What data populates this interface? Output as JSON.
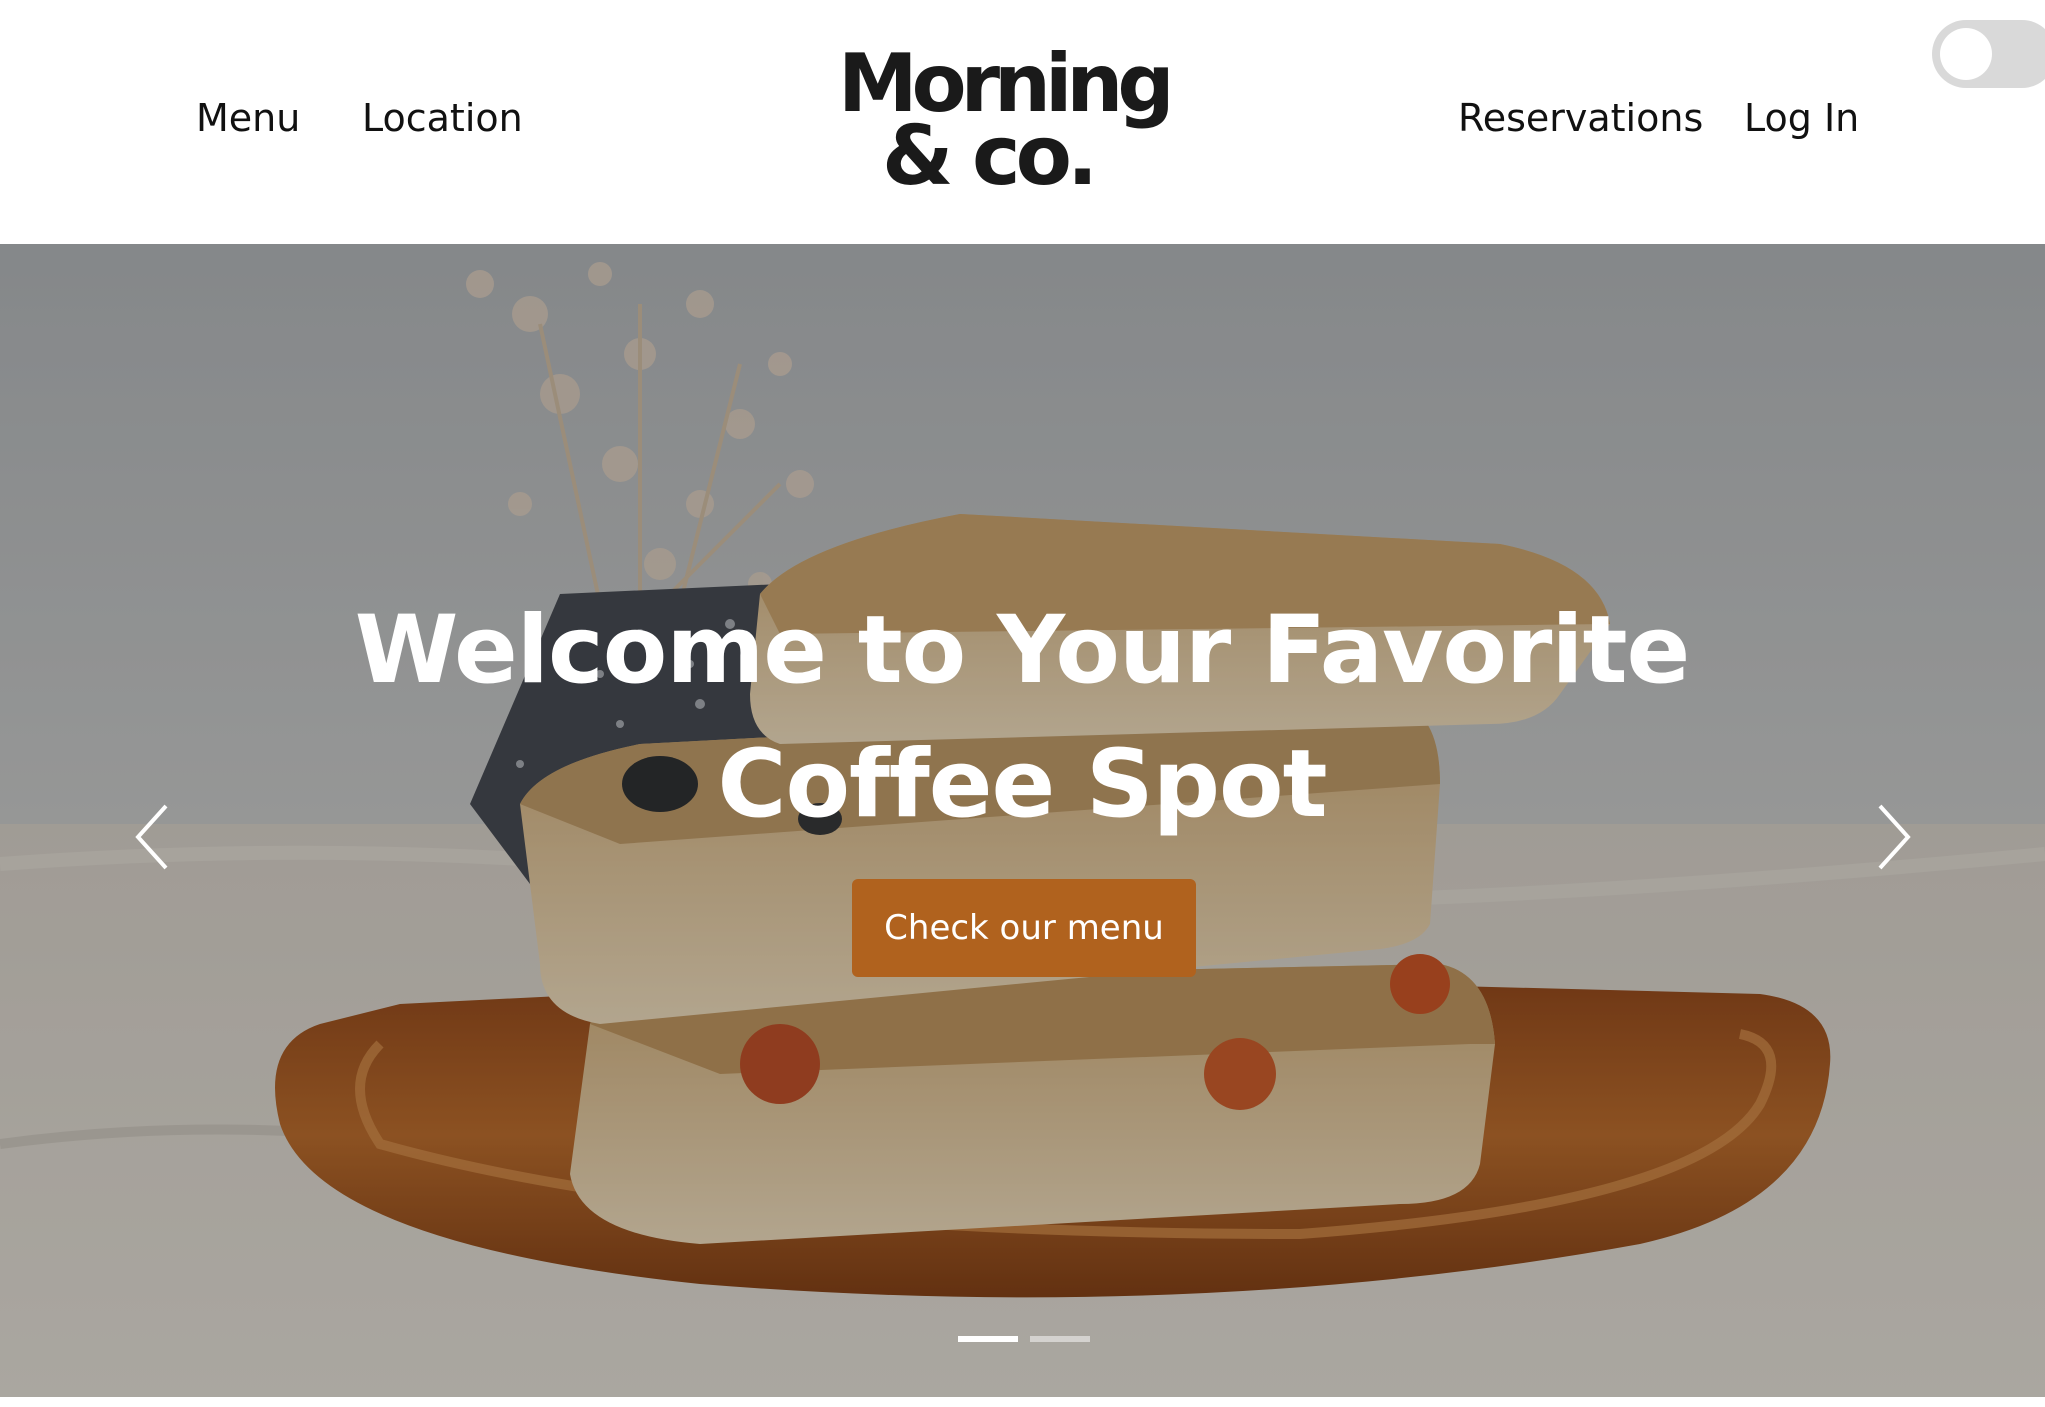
{
  "header": {
    "nav_left": [
      {
        "label": "Menu"
      },
      {
        "label": "Location"
      }
    ],
    "nav_right": [
      {
        "label": "Reservations"
      },
      {
        "label": "Log In"
      }
    ],
    "logo": {
      "line1": "Morning",
      "line2": "& co."
    },
    "theme_toggle": {
      "state": "off"
    }
  },
  "hero": {
    "title": "Welcome to Your Favorite Coffee Spot",
    "cta_label": "Check our menu",
    "carousel": {
      "slide_count": 2,
      "active_slide": 1,
      "prev_icon": "chevron-left-icon",
      "next_icon": "chevron-right-icon"
    }
  },
  "colors": {
    "accent": "#b0621e",
    "text": "#111111",
    "toggle_bg": "#d9d9d9"
  }
}
